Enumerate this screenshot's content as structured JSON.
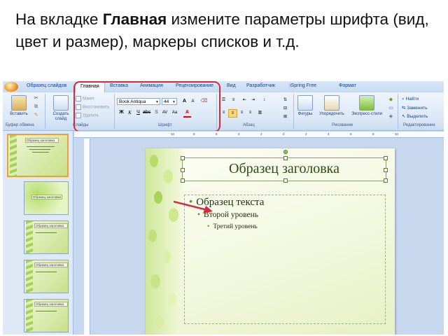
{
  "caption": {
    "prefix": "На вкладке ",
    "bold": "Главная",
    "suffix": " измените параметры шрифта (вид, цвет и размер), маркеры списков и т.д."
  },
  "tabs": [
    "Образец слайдов",
    "Главная",
    "Вставка",
    "Анимация",
    "Рецензирование",
    "Вид",
    "Разработчик",
    "iSpring Free",
    "Формат"
  ],
  "ribbon": {
    "clipboard": {
      "paste": "Вставить",
      "group": "Буфер обмена"
    },
    "slides": {
      "new_slide": "Создать слайд",
      "layout": "Макет",
      "reset": "Восстановить",
      "delete": "Удалить",
      "group": "Слайды"
    },
    "font": {
      "face": "Book Antiqua",
      "size": "44",
      "group": "Шрифт"
    },
    "paragraph": {
      "group": "Абзац"
    },
    "drawing": {
      "shapes": "Фигуры",
      "arrange": "Упорядочить",
      "styles": "Экспресс-стили",
      "group": "Рисование"
    },
    "editing": {
      "find": "Найти",
      "replace": "Заменить",
      "select": "Выделить",
      "group": "Редактирование"
    }
  },
  "slide": {
    "title": "Образец заголовка",
    "level1": "Образец текста",
    "level2": "Второй уровень",
    "level3": "Третий уровень"
  },
  "thumbs": [
    {
      "num": "1",
      "title": "Образец заголовка"
    },
    {
      "num": "",
      "title": "Образец заголовка"
    },
    {
      "num": "",
      "title": "Образец заголовка"
    },
    {
      "num": "",
      "title": "Образец заголовка"
    },
    {
      "num": "",
      "title": "Образец заголовка"
    }
  ],
  "ruler": [
    "10",
    "8",
    "6",
    "4",
    "2",
    "0",
    "2",
    "4",
    "6",
    "8",
    "10"
  ]
}
